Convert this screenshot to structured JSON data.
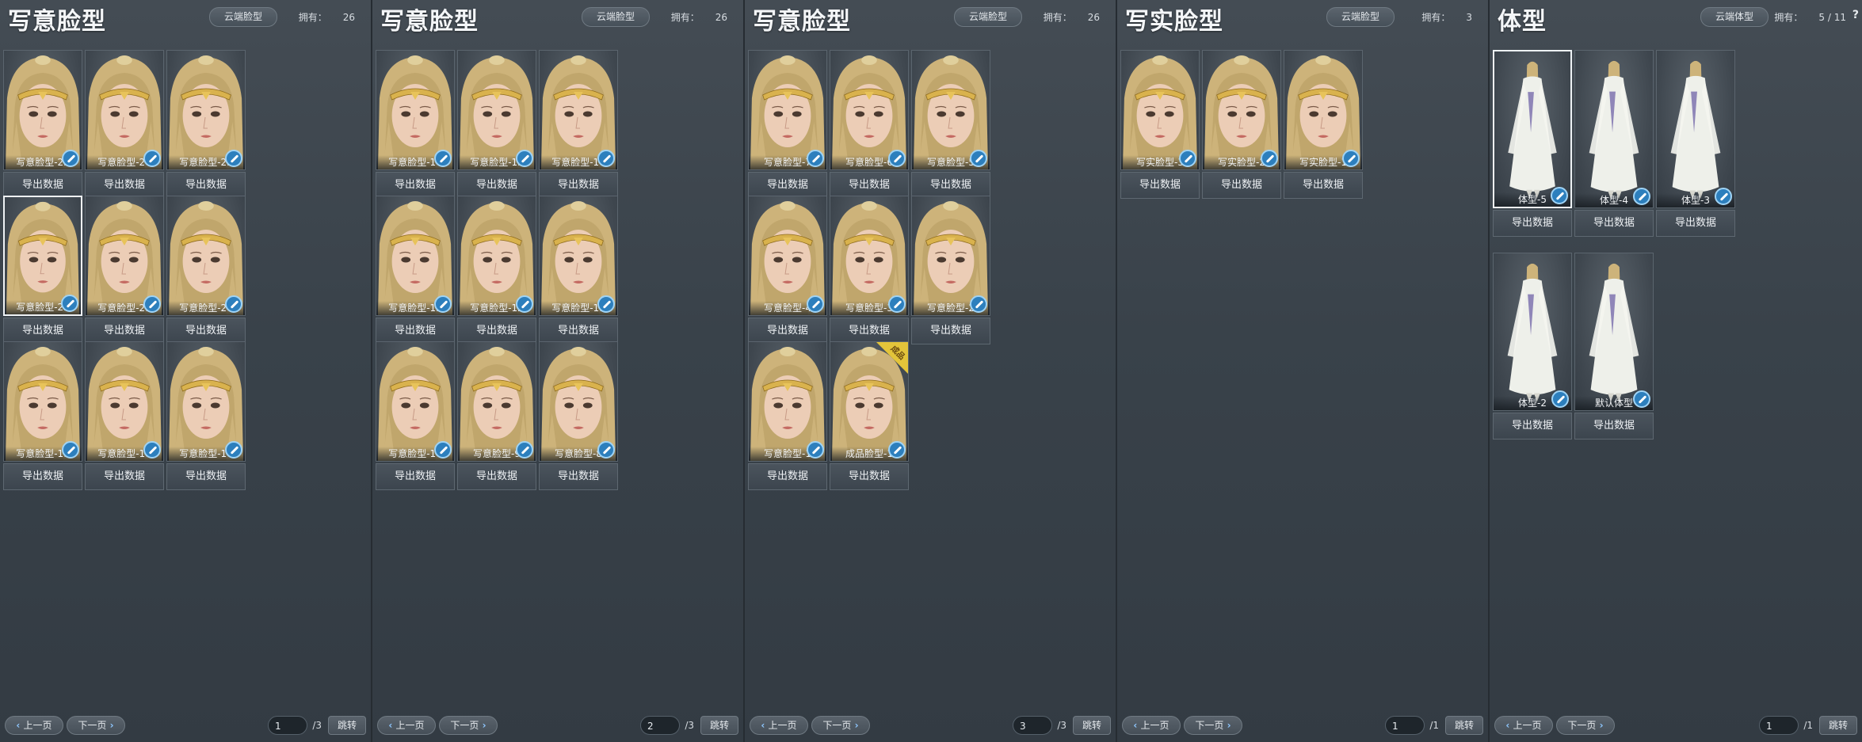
{
  "panels": [
    {
      "title": "写意脸型",
      "cloud_button": "云端脸型",
      "owned_label": "拥有：",
      "owned_count": "26",
      "kind": "face",
      "items": [
        {
          "label": "写意脸型-25"
        },
        {
          "label": "写意脸型-24"
        },
        {
          "label": "写意脸型-23"
        },
        {
          "label": "写意脸型-22",
          "selected": true
        },
        {
          "label": "写意脸型-21"
        },
        {
          "label": "写意脸型-20"
        },
        {
          "label": "写意脸型-19"
        },
        {
          "label": "写意脸型-18"
        },
        {
          "label": "写意脸型-17"
        }
      ],
      "export_label": "导出数据",
      "prev_label": "上一页",
      "next_label": "下一页",
      "page": "1",
      "total": "/3",
      "jump_label": "跳转"
    },
    {
      "title": "写意脸型",
      "cloud_button": "云端脸型",
      "owned_label": "拥有：",
      "owned_count": "26",
      "kind": "face",
      "items": [
        {
          "label": "写意脸型-16"
        },
        {
          "label": "写意脸型-15"
        },
        {
          "label": "写意脸型-14"
        },
        {
          "label": "写意脸型-13"
        },
        {
          "label": "写意脸型-12"
        },
        {
          "label": "写意脸型-11"
        },
        {
          "label": "写意脸型-10"
        },
        {
          "label": "写意脸型-9"
        },
        {
          "label": "写意脸型-8"
        }
      ],
      "export_label": "导出数据",
      "prev_label": "上一页",
      "next_label": "下一页",
      "page": "2",
      "total": "/3",
      "jump_label": "跳转"
    },
    {
      "title": "写意脸型",
      "cloud_button": "云端脸型",
      "owned_label": "拥有：",
      "owned_count": "26",
      "kind": "face",
      "items": [
        {
          "label": "写意脸型-7"
        },
        {
          "label": "写意脸型-6"
        },
        {
          "label": "写意脸型-5"
        },
        {
          "label": "写意脸型-4"
        },
        {
          "label": "写意脸型-3"
        },
        {
          "label": "写意脸型-2"
        },
        {
          "label": "写意脸型-1"
        },
        {
          "label": "成品脸型-1",
          "badge": "成品"
        }
      ],
      "export_label": "导出数据",
      "prev_label": "上一页",
      "next_label": "下一页",
      "page": "3",
      "total": "/3",
      "jump_label": "跳转"
    },
    {
      "title": "写实脸型",
      "cloud_button": "云端脸型",
      "owned_label": "拥有：",
      "owned_count": "3",
      "kind": "face",
      "items": [
        {
          "label": "写实脸型-3"
        },
        {
          "label": "写实脸型-2"
        },
        {
          "label": "写实脸型-1"
        }
      ],
      "export_label": "导出数据",
      "prev_label": "上一页",
      "next_label": "下一页",
      "page": "1",
      "total": "/1",
      "jump_label": "跳转"
    },
    {
      "title": "体型",
      "cloud_button": "云端体型",
      "owned_label": "拥有：",
      "owned_count": "5 / 11",
      "help": "?",
      "kind": "body",
      "items": [
        {
          "label": "体型-5",
          "selected": true
        },
        {
          "label": "体型-4"
        },
        {
          "label": "体型-3"
        },
        {
          "label": "体型-2"
        },
        {
          "label": "默认体型"
        }
      ],
      "export_label": "导出数据",
      "prev_label": "上一页",
      "next_label": "下一页",
      "page": "1",
      "total": "/1",
      "jump_label": "跳转"
    }
  ]
}
